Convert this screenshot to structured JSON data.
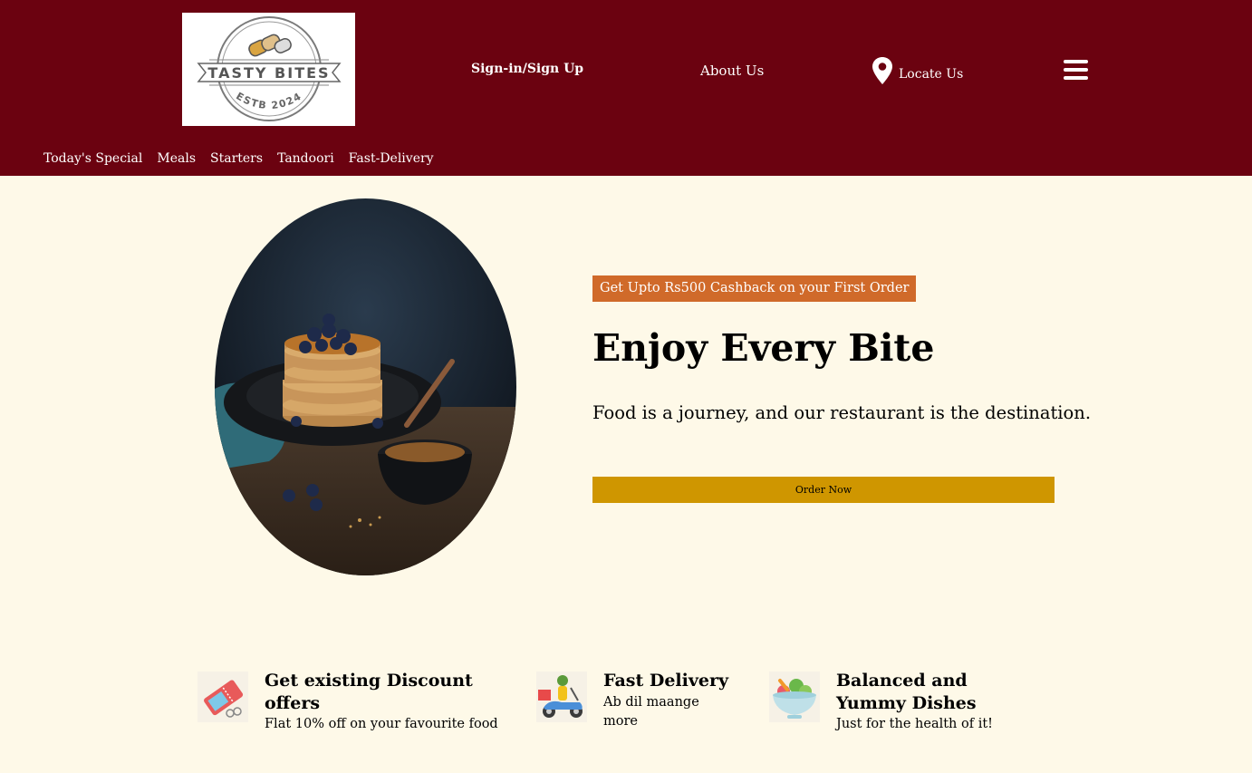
{
  "brand": {
    "logo_text_top": "TASTY BITES",
    "logo_text_bottom": "ESTB 2024"
  },
  "header": {
    "signin_label": "Sign-in/Sign Up",
    "about_label": "About Us",
    "locate_label": "Locate Us",
    "menu_icon": "hamburger-menu-icon",
    "location_icon": "map-pin-icon"
  },
  "subnav": {
    "items": [
      {
        "label": "Today's Special"
      },
      {
        "label": "Meals"
      },
      {
        "label": "Starters"
      },
      {
        "label": "Tandoori"
      },
      {
        "label": "Fast-Delivery"
      }
    ]
  },
  "hero": {
    "promo": "Get Upto Rs500 Cashback on your First Order",
    "title": "Enjoy Every Bite",
    "subtitle": "Food is a journey, and our restaurant is the destination.",
    "cta_label": "Order Now"
  },
  "features": [
    {
      "title": "Get existing Discount offers",
      "desc": "Flat 10% off on your favourite food",
      "icon": "coupon-icon"
    },
    {
      "title": "Fast Delivery",
      "desc": "Ab dil maange more",
      "icon": "delivery-scooter-icon"
    },
    {
      "title": "Balanced and Yummy Dishes",
      "desc": "Just for the health of it!",
      "icon": "salad-bowl-icon"
    }
  ],
  "colors": {
    "header_bg": "#6b0210",
    "page_bg": "#fef9e8",
    "promo_bg": "#d06a2a",
    "cta_bg": "#cf9600"
  }
}
